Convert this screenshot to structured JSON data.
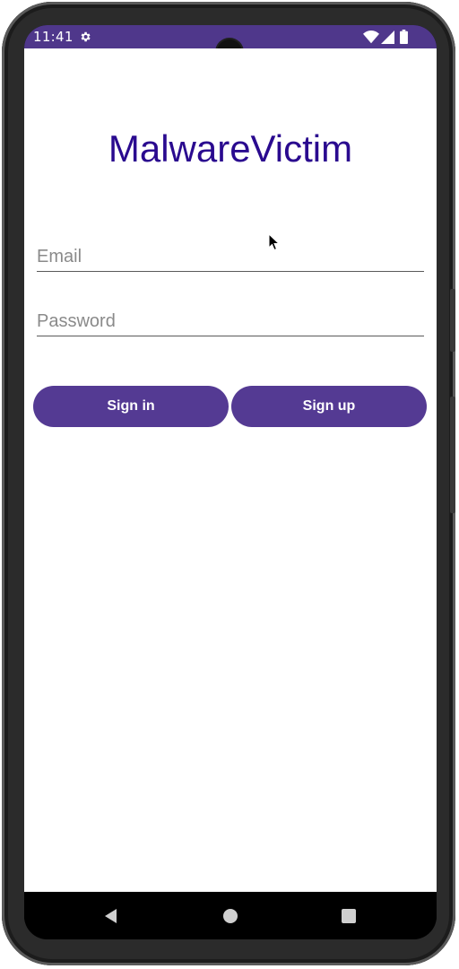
{
  "status_bar": {
    "time": "11:41",
    "icons": [
      "gear-icon",
      "wifi-icon",
      "signal-icon",
      "battery-icon"
    ],
    "color": "#4f378b"
  },
  "app": {
    "title": "MalwareVictim",
    "title_color": "#2a0a8f",
    "email": {
      "placeholder": "Email",
      "value": ""
    },
    "password": {
      "placeholder": "Password",
      "value": ""
    },
    "buttons": {
      "sign_in": "Sign in",
      "sign_up": "Sign up",
      "color": "#543a93"
    }
  },
  "nav_bar": {
    "icons": [
      "back-icon",
      "home-icon",
      "recents-icon"
    ]
  }
}
